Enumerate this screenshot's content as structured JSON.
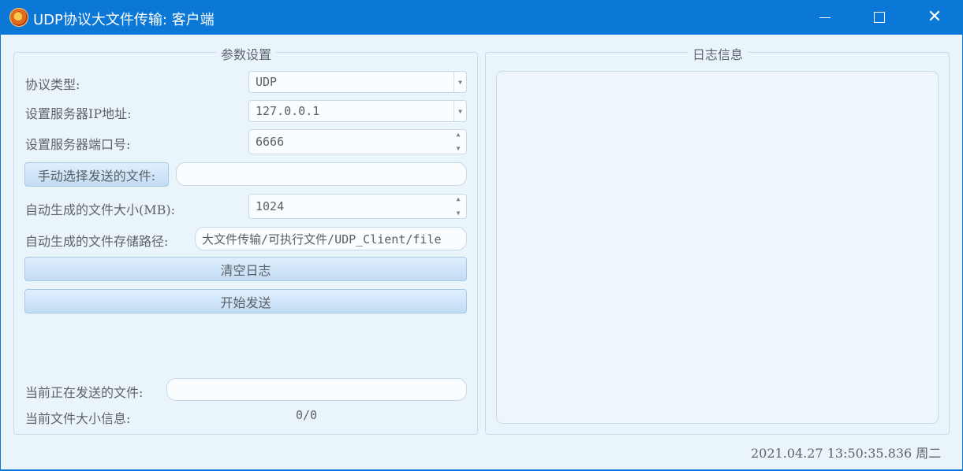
{
  "window": {
    "title": "UDP协议大文件传输: 客户端",
    "minimize": "—",
    "maximize": "☐",
    "close": "✕"
  },
  "params": {
    "group_title": "参数设置",
    "protocol_label": "协议类型:",
    "protocol_value": "UDP",
    "server_ip_label": "设置服务器IP地址:",
    "server_ip_value": "127.0.0.1",
    "server_port_label": "设置服务器端口号:",
    "server_port_value": "6666",
    "choose_file_button": "手动选择发送的文件:",
    "chosen_file_value": "",
    "auto_size_label": "自动生成的文件大小(MB):",
    "auto_size_value": "1024",
    "auto_path_label": "自动生成的文件存储路径:",
    "auto_path_value": "大文件传输/可执行文件/UDP_Client/file",
    "clear_log_button": "清空日志",
    "start_send_button": "开始发送",
    "current_file_label": "当前正在发送的文件:",
    "current_file_value": "",
    "current_size_label": "当前文件大小信息:",
    "current_size_value": "0/0"
  },
  "log": {
    "group_title": "日志信息"
  },
  "status": {
    "datetime": "2021.04.27 13:50:35.836 周二"
  },
  "colors": {
    "titlebar": "#0b78d7",
    "background": "#eaf4fb",
    "button_gradient_top": "#e0efff",
    "button_gradient_bottom": "#c3dcf3"
  }
}
